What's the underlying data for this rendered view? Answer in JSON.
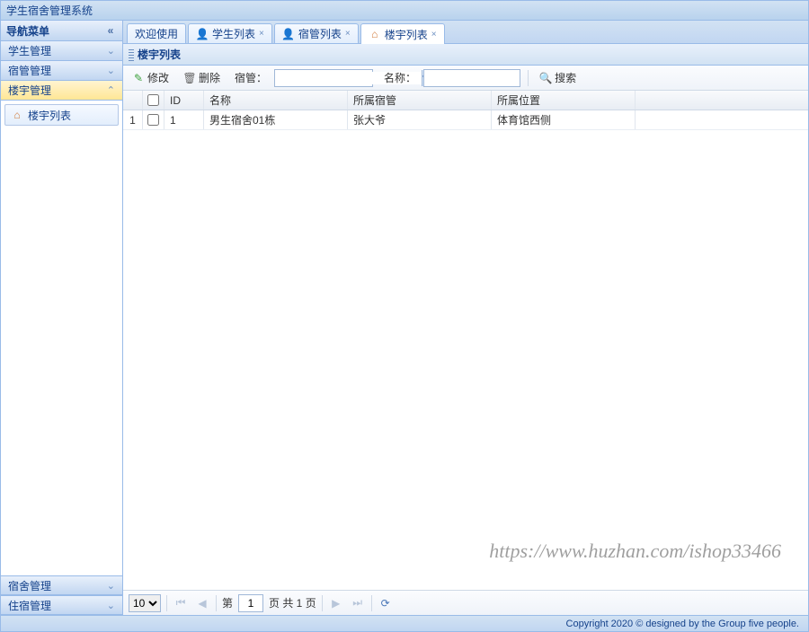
{
  "app_title": "学生宿舍管理系统",
  "sidebar": {
    "header": "导航菜单",
    "groups": {
      "student": "学生管理",
      "manager": "宿管管理",
      "building": "楼宇管理",
      "dorm": "宿舍管理",
      "stay": "住宿管理"
    },
    "items": {
      "building_list": "楼宇列表"
    }
  },
  "tabs": {
    "welcome": "欢迎使用",
    "student_list": "学生列表",
    "manager_list": "宿管列表",
    "building_list": "楼宇列表"
  },
  "panel": {
    "title": "楼宇列表"
  },
  "toolbar": {
    "edit": "修改",
    "delete": "删除",
    "manager_label": "宿管：",
    "name_label": "名称：",
    "search": "搜索"
  },
  "grid": {
    "headers": {
      "id": "ID",
      "name": "名称",
      "manager": "所属宿管",
      "location": "所属位置"
    },
    "rows": [
      {
        "rownum": "1",
        "id": "1",
        "name": "男生宿舍01栋",
        "manager": "张大爷",
        "location": "体育馆西侧"
      }
    ]
  },
  "pager": {
    "page_size": "10",
    "before_page": "第",
    "page": "1",
    "after_page": "页 共 1 页"
  },
  "watermark": "https://www.huzhan.com/ishop33466",
  "footer": "Copyright 2020 © designed by the Group five people."
}
